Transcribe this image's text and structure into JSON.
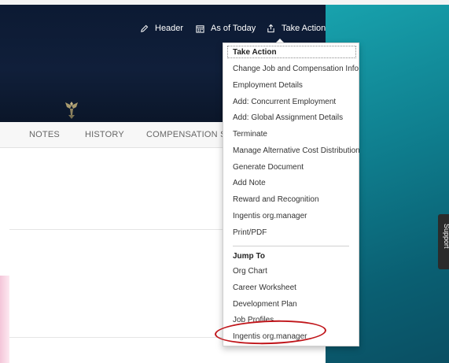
{
  "actions": {
    "header_label": "Header",
    "as_of_today_label": "As of Today",
    "take_action_label": "Take Action"
  },
  "tabs": [
    "NOTES",
    "HISTORY",
    "COMPENSATION STATE"
  ],
  "menu": {
    "title": "Take Action",
    "items": [
      "Change Job and Compensation Info",
      "Employment Details",
      "Add: Concurrent Employment",
      "Add: Global Assignment Details",
      "Terminate",
      "Manage Alternative Cost Distribution",
      "Generate Document",
      "Add Note",
      "Reward and Recognition",
      "Ingentis org.manager",
      "Print/PDF"
    ],
    "jump_to_title": "Jump To",
    "jump_items": [
      "Org Chart",
      "Career Worksheet",
      "Development Plan",
      "Job Profiles",
      "Ingentis org.manager"
    ]
  },
  "support_label": "Support",
  "colors": {
    "hero_bg": "#0c1a33",
    "teal_bg": "#0f7f8f",
    "highlight": "#c0161b"
  },
  "icons": [
    "pencil-icon",
    "calendar-icon",
    "share-icon",
    "eagle-emblem-icon"
  ]
}
